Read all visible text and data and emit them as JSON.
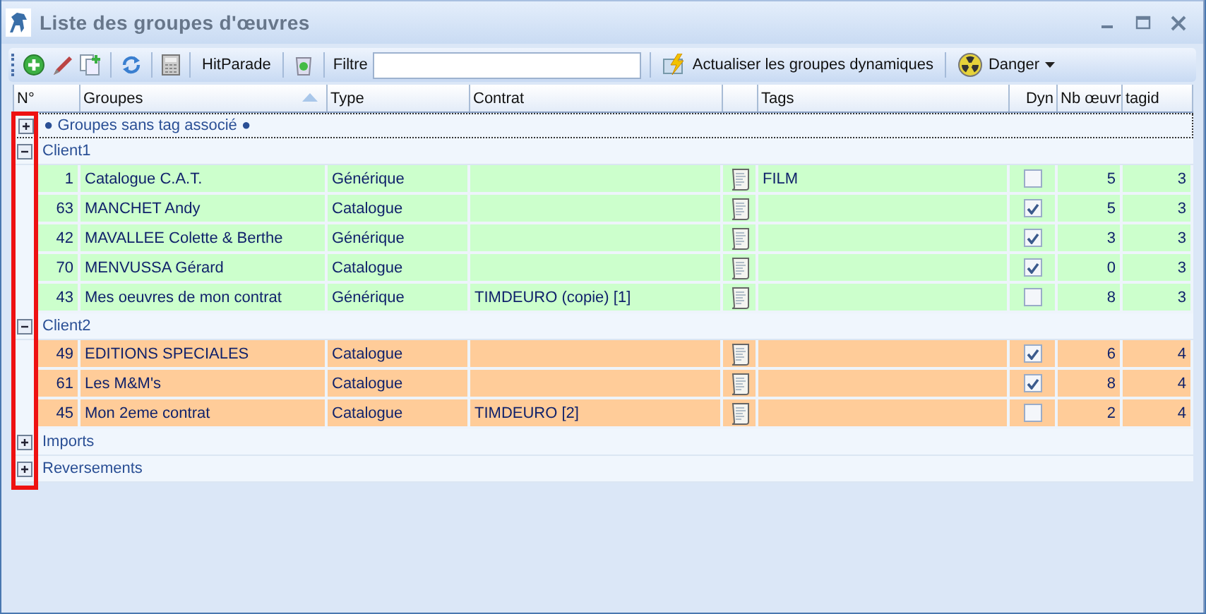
{
  "window": {
    "title": "Liste des groupes d'œuvres"
  },
  "toolbar": {
    "buttons": [
      {
        "label": "HitParade"
      },
      {
        "label": "Actualiser les groupes dynamiques"
      },
      {
        "label": "Danger"
      }
    ],
    "filter": {
      "label": "Filtre"
    }
  },
  "table": {
    "columns": [
      {
        "label": "N°",
        "sorted": false
      },
      {
        "label": "Groupes",
        "sorted": true
      },
      {
        "label": "Type",
        "sorted": false
      },
      {
        "label": "Contrat",
        "sorted": false
      },
      {
        "sorted": false
      },
      {
        "label": "Tags",
        "sorted": false
      },
      {
        "label": "Dyn",
        "sorted": false
      },
      {
        "label": "Nb œuvr",
        "sorted": false
      },
      {
        "label": "tagid",
        "sorted": false
      }
    ],
    "groups": [
      {
        "label": "● Groupes sans tag associé ●",
        "expanded": false
      },
      {
        "label": "Client1",
        "expanded": true,
        "color": "#ccffcc",
        "rows": [
          {
            "no": "1",
            "name": "Catalogue C.A.T.",
            "type": "Générique",
            "tags": "FILM",
            "dyn": false,
            "count": "5",
            "tagid": "3"
          },
          {
            "no": "63",
            "name": "MANCHET Andy",
            "type": "Catalogue",
            "dyn": true,
            "count": "5",
            "tagid": "3"
          },
          {
            "no": "42",
            "name": "MAVALLEE Colette & Berthe",
            "type": "Générique",
            "dyn": true,
            "count": "3",
            "tagid": "3"
          },
          {
            "no": "70",
            "name": "MENVUSSA Gérard",
            "type": "Catalogue",
            "dyn": true,
            "count": "0",
            "tagid": "3"
          },
          {
            "no": "43",
            "name": "Mes oeuvres de mon contrat",
            "type": "Générique",
            "contract": "TIMDEURO (copie) [1]",
            "dyn": false,
            "count": "8",
            "tagid": "3"
          }
        ]
      },
      {
        "label": "Client2",
        "expanded": true,
        "color": "#ffcc99",
        "rows": [
          {
            "no": "49",
            "name": "EDITIONS SPECIALES",
            "type": "Catalogue",
            "dyn": true,
            "count": "6",
            "tagid": "4"
          },
          {
            "no": "61",
            "name": "Les M&M's",
            "type": "Catalogue",
            "dyn": true,
            "count": "8",
            "tagid": "4"
          },
          {
            "no": "45",
            "name": "Mon 2eme contrat",
            "type": "Catalogue",
            "contract": "TIMDEURO [2]",
            "dyn": false,
            "count": "2",
            "tagid": "4"
          }
        ]
      },
      {
        "label": "Imports",
        "expanded": false
      },
      {
        "label": "Reversements",
        "expanded": false
      }
    ]
  }
}
